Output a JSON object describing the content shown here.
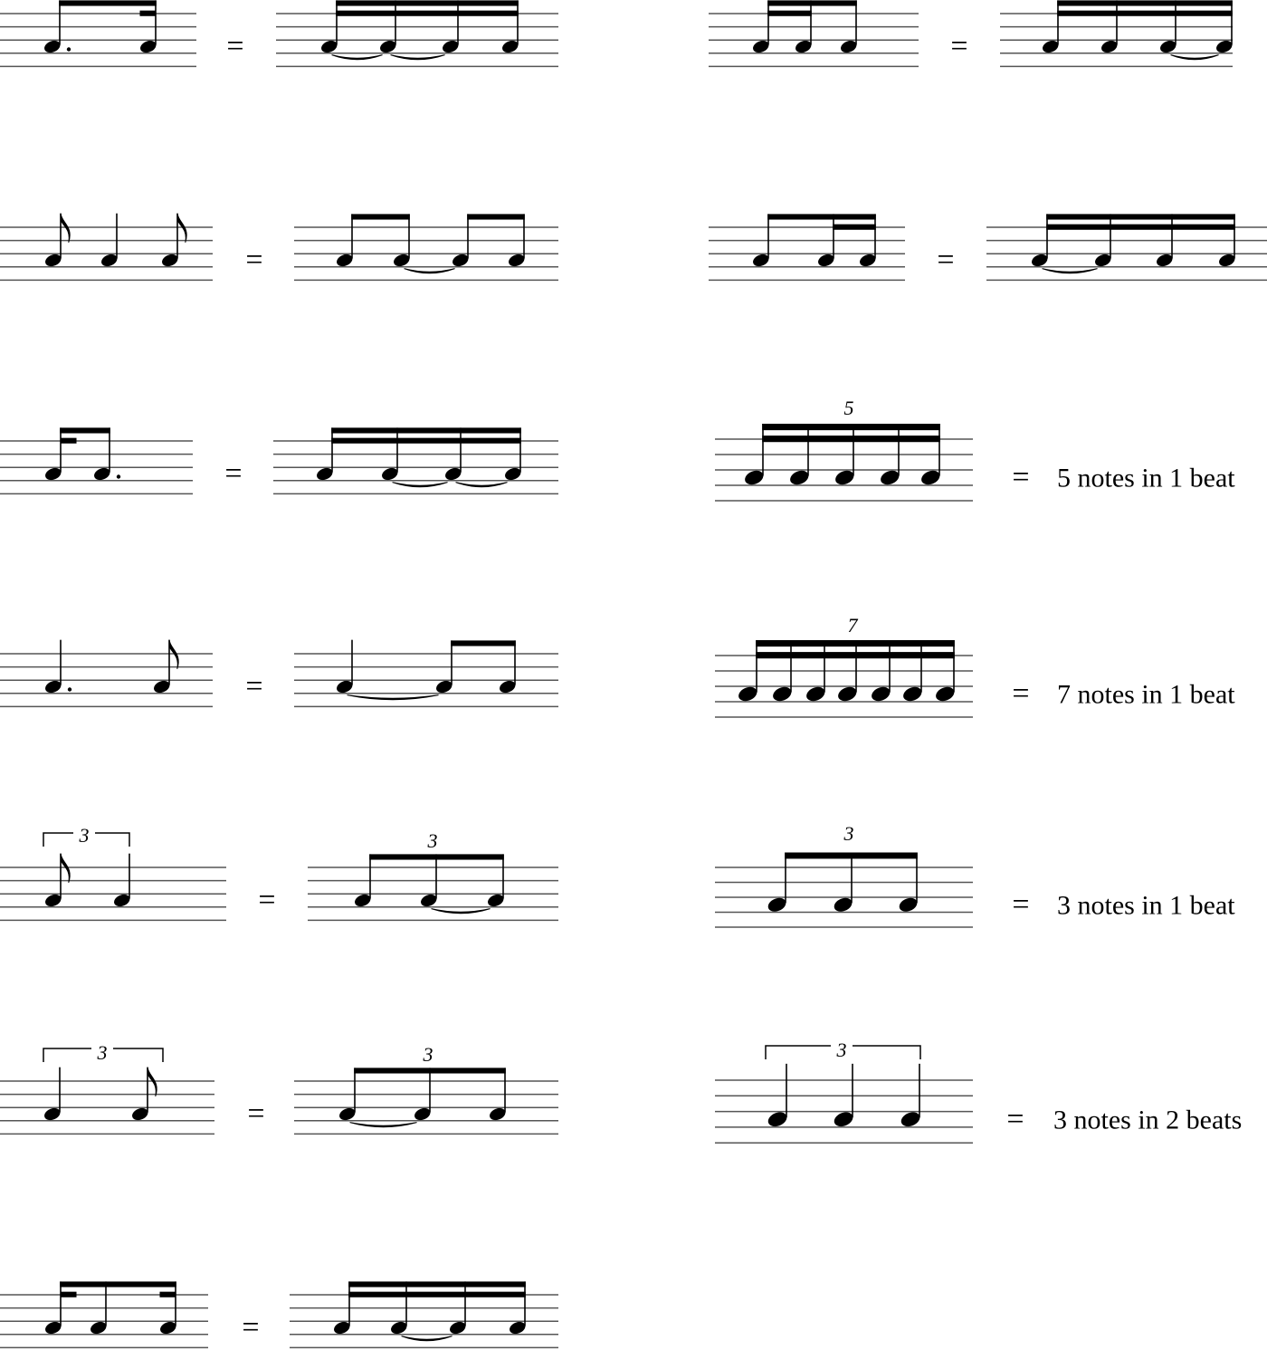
{
  "equals_sign": "=",
  "examples": [
    {
      "id": "r1-left",
      "lhs": {
        "durations": [
          0.75,
          0.25
        ]
      },
      "rhs": {
        "durations": [
          0.25,
          0.25,
          0.25,
          0.25
        ],
        "tied_after": [
          0,
          1
        ]
      }
    },
    {
      "id": "r1-right",
      "lhs": {
        "durations": [
          0.25,
          0.25,
          0.5
        ]
      },
      "rhs": {
        "durations": [
          0.25,
          0.25,
          0.25,
          0.25
        ],
        "tied_after": [
          2
        ]
      }
    },
    {
      "id": "r2-left",
      "lhs": {
        "durations": [
          0.5,
          1,
          0.5
        ]
      },
      "rhs": {
        "durations": [
          0.5,
          0.5,
          0.5,
          0.5
        ],
        "tied_after": [
          1
        ]
      }
    },
    {
      "id": "r2-right",
      "lhs": {
        "durations": [
          0.5,
          0.25,
          0.25
        ]
      },
      "rhs": {
        "durations": [
          0.25,
          0.25,
          0.25,
          0.25
        ],
        "tied_after": [
          0
        ]
      }
    },
    {
      "id": "r3-left",
      "lhs": {
        "durations": [
          0.25,
          0.75
        ]
      },
      "rhs": {
        "durations": [
          0.25,
          0.25,
          0.25,
          0.25
        ],
        "tied_after": [
          1,
          2
        ]
      }
    },
    {
      "id": "r3-right",
      "lhs": {
        "durations": [
          0.2,
          0.2,
          0.2,
          0.2,
          0.2
        ],
        "tuplet": "5"
      },
      "caption": "5 notes in 1 beat"
    },
    {
      "id": "r4-left",
      "lhs": {
        "durations": [
          1.5,
          0.5
        ]
      },
      "rhs": {
        "durations": [
          1,
          0.5,
          0.5
        ],
        "tied_after": [
          0
        ]
      }
    },
    {
      "id": "r4-right",
      "lhs": {
        "durations": [
          0.142857,
          0.142857,
          0.142857,
          0.142857,
          0.142857,
          0.142857,
          0.142857
        ],
        "tuplet": "7"
      },
      "caption": "7 notes in 1 beat"
    },
    {
      "id": "r5-left",
      "lhs": {
        "durations": [
          0.5,
          1
        ],
        "tuplet": "3"
      },
      "rhs": {
        "durations": [
          0.5,
          0.5,
          0.5
        ],
        "tied_after": [
          1
        ],
        "tuplet": "3"
      }
    },
    {
      "id": "r5-right",
      "lhs": {
        "durations": [
          0.5,
          0.5,
          0.5
        ],
        "tuplet": "3"
      },
      "caption": "3 notes in 1 beat"
    },
    {
      "id": "r6-left",
      "lhs": {
        "durations": [
          1,
          0.5
        ],
        "tuplet": "3"
      },
      "rhs": {
        "durations": [
          0.5,
          0.5,
          0.5
        ],
        "tied_after": [
          0
        ],
        "tuplet": "3"
      }
    },
    {
      "id": "r6-right",
      "lhs": {
        "durations": [
          1,
          1,
          1
        ],
        "tuplet": "3"
      },
      "caption": "3 notes in 2 beats"
    },
    {
      "id": "r7-left",
      "lhs": {
        "durations": [
          0.25,
          0.5,
          0.25
        ]
      },
      "rhs": {
        "durations": [
          0.25,
          0.25,
          0.25,
          0.25
        ],
        "tied_after": [
          1
        ]
      }
    }
  ]
}
